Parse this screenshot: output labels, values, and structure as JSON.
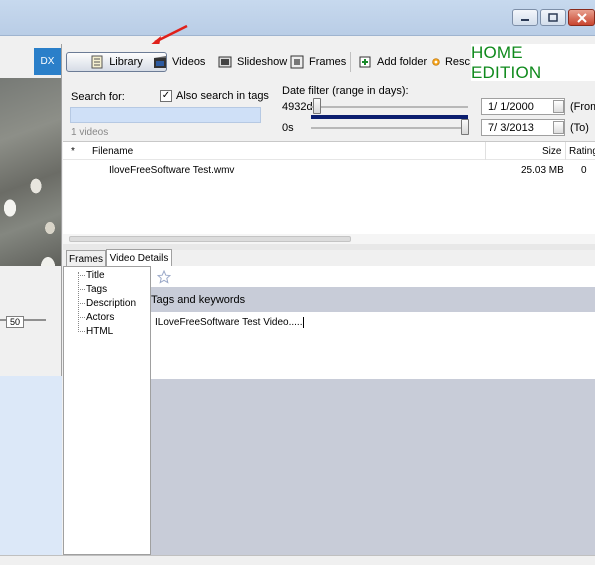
{
  "toolbar": {
    "library_label": "Library",
    "videos_label": "Videos",
    "slideshow_label": "Slideshow",
    "frames_label": "Frames",
    "add_folder_label": "Add folder",
    "rescan_label": "Resc",
    "edition_label": "HOME EDITION",
    "dx_label": "DX"
  },
  "search": {
    "label": "Search for:",
    "value": "",
    "also_search_tags_label": "Also search in tags",
    "also_search_tags_checked": true,
    "video_count": "1 videos"
  },
  "date_filter": {
    "label": "Date filter (range in days):",
    "slider_top_label": "4932d",
    "slider_bottom_label": "0s",
    "from_date": "1/ 1/2000",
    "to_date": "7/ 3/2013",
    "from_label": "(From",
    "to_label": "(To)"
  },
  "file_list": {
    "columns": [
      "*",
      "Filename",
      "Size",
      "Rating"
    ],
    "rows": [
      {
        "star": "",
        "filename": "IloveFreeSoftware Test.wmv",
        "size": "25.03 MB",
        "rating": "0"
      }
    ]
  },
  "lower_tabs": [
    "Frames",
    "Video Details"
  ],
  "active_tab": "Video Details",
  "tree_items": [
    "Title",
    "Tags",
    "Description",
    "Actors",
    "HTML"
  ],
  "details": {
    "tags_header": "Tags and keywords",
    "tags_value": "ILoveFreeSoftware Test Video....."
  },
  "zoom_value": "50",
  "colors": {
    "edition_text": "#0f8a1c",
    "date_range_bar": "#0b1e6f",
    "dx_button": "#2a7fc9",
    "annotation_arrow": "#e0201a"
  }
}
